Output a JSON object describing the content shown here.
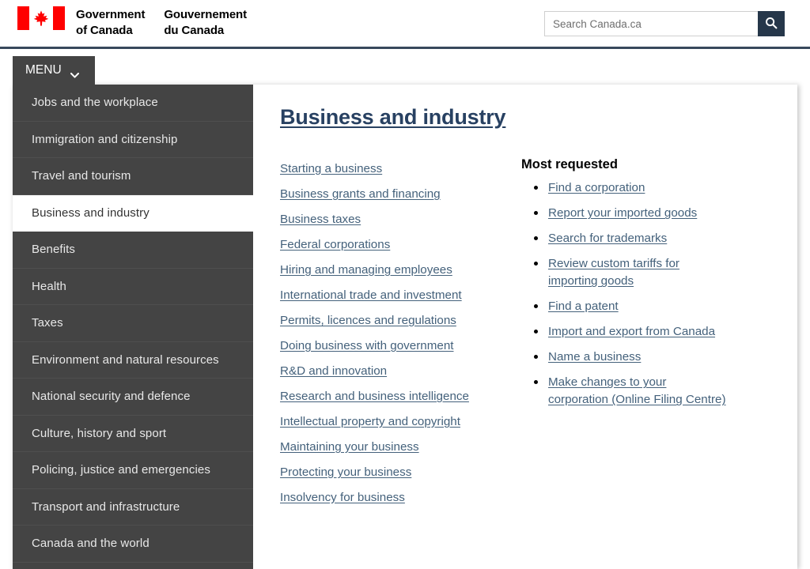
{
  "header": {
    "flag_icon": "canada-flag-icon",
    "wordmark_en": "Government\nof Canada",
    "wordmark_fr": "Gouvernement\ndu Canada",
    "search": {
      "placeholder": "Search Canada.ca",
      "value": "",
      "button_icon": "search-icon"
    }
  },
  "menu": {
    "button_label": "MENU",
    "chevron_icon": "chevron-down-icon",
    "themes": [
      {
        "label": "Jobs and the workplace",
        "active": false
      },
      {
        "label": "Immigration and citizenship",
        "active": false
      },
      {
        "label": "Travel and tourism",
        "active": false
      },
      {
        "label": "Business and industry",
        "active": true
      },
      {
        "label": "Benefits",
        "active": false
      },
      {
        "label": "Health",
        "active": false
      },
      {
        "label": "Taxes",
        "active": false
      },
      {
        "label": "Environment and natural resources",
        "active": false
      },
      {
        "label": "National security and defence",
        "active": false
      },
      {
        "label": "Culture, history and sport",
        "active": false
      },
      {
        "label": "Policing, justice and emergencies",
        "active": false
      },
      {
        "label": "Transport and infrastructure",
        "active": false
      },
      {
        "label": "Canada and the world",
        "active": false
      }
    ]
  },
  "panel": {
    "title": "Business and industry",
    "links": [
      "Starting a business",
      "Business grants and financing",
      "Business taxes",
      "Federal corporations",
      "Hiring and managing employees",
      "International trade and investment",
      "Permits, licences and regulations",
      "Doing business with government",
      "R&D and innovation",
      "Research and business intelligence",
      "Intellectual property and copyright",
      "Maintaining your business",
      "Protecting your business",
      "Insolvency for business"
    ],
    "most_requested_title": "Most requested",
    "most_requested": [
      "Find a corporation",
      "Report your imported goods",
      "Search for trademarks",
      "Review custom tariffs for importing goods",
      "Find a patent",
      "Import and export from Canada",
      "Name a business",
      "Make changes to your corporation (Online Filing Centre)"
    ]
  },
  "colors": {
    "flag_red": "#ff0000",
    "header_rule": "#38485c",
    "nav_background": "#444444",
    "search_button": "#26374a",
    "title_link": "#284162",
    "body_link": "#44617b"
  }
}
